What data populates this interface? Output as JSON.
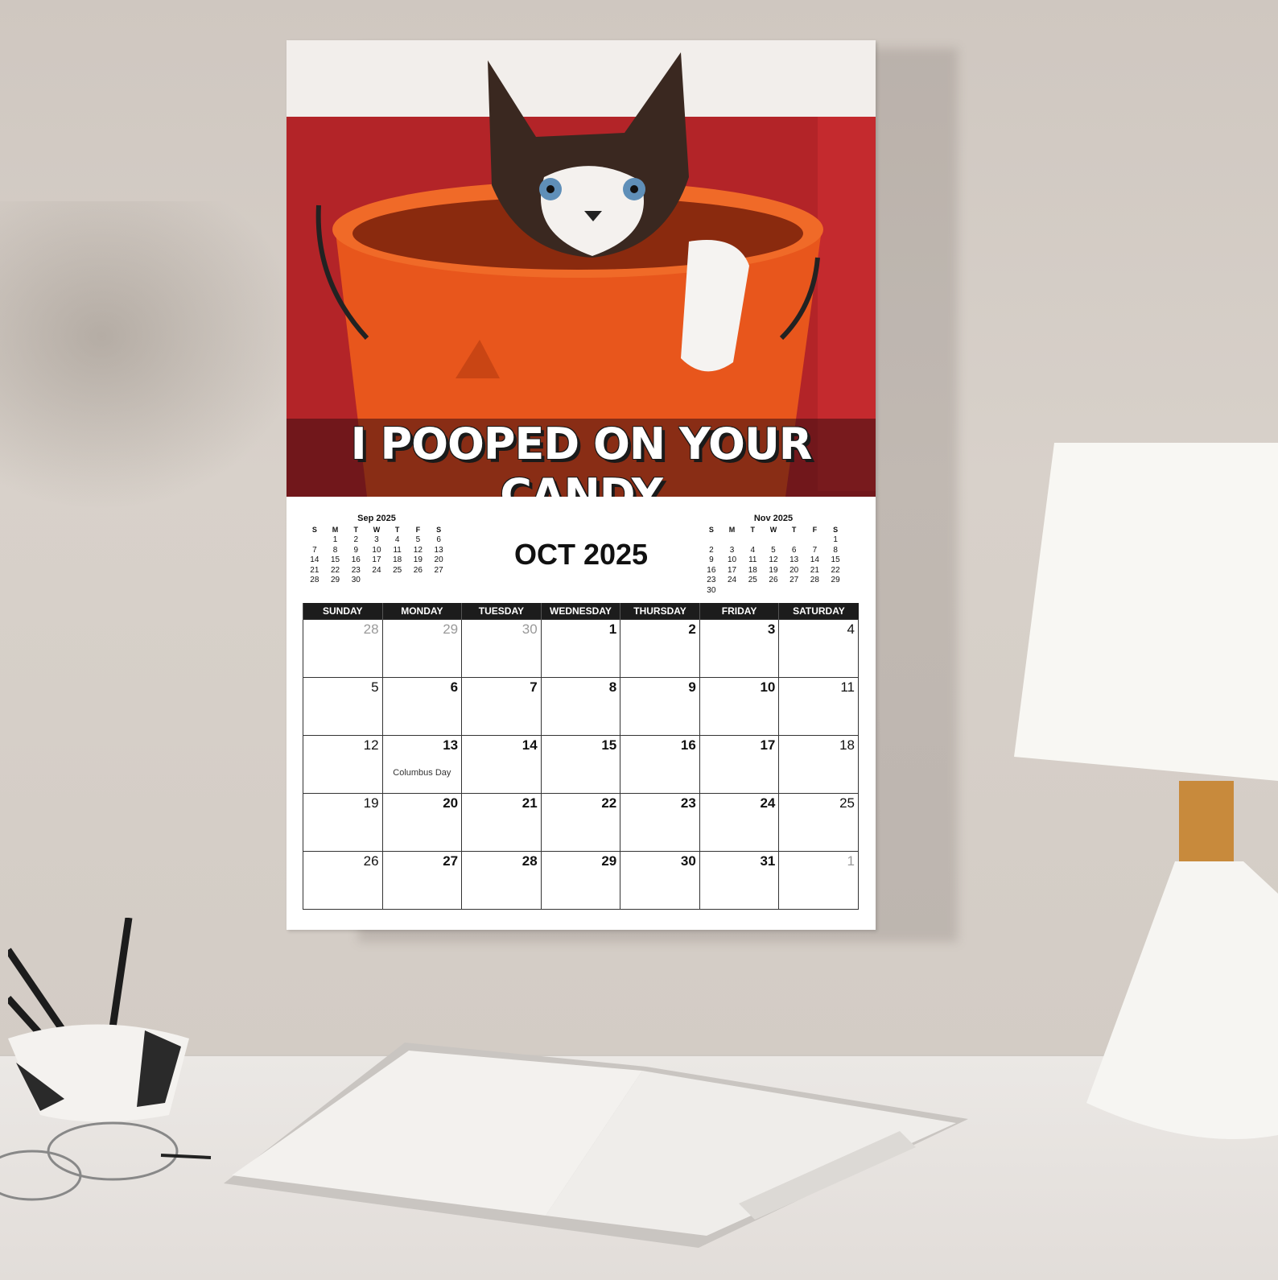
{
  "calendar": {
    "caption": "I POOPED ON YOUR CANDY",
    "month_title": "OCT 2025",
    "prev_month": {
      "title": "Sep 2025",
      "weekday_letters": [
        "S",
        "M",
        "T",
        "W",
        "T",
        "F",
        "S"
      ],
      "weeks": [
        [
          "",
          "1",
          "2",
          "3",
          "4",
          "5",
          "6"
        ],
        [
          "7",
          "8",
          "9",
          "10",
          "11",
          "12",
          "13"
        ],
        [
          "14",
          "15",
          "16",
          "17",
          "18",
          "19",
          "20"
        ],
        [
          "21",
          "22",
          "23",
          "24",
          "25",
          "26",
          "27"
        ],
        [
          "28",
          "29",
          "30",
          "",
          "",
          "",
          ""
        ]
      ]
    },
    "next_month": {
      "title": "Nov 2025",
      "weekday_letters": [
        "S",
        "M",
        "T",
        "W",
        "T",
        "F",
        "S"
      ],
      "weeks": [
        [
          "",
          "",
          "",
          "",
          "",
          "",
          "1"
        ],
        [
          "2",
          "3",
          "4",
          "5",
          "6",
          "7",
          "8"
        ],
        [
          "9",
          "10",
          "11",
          "12",
          "13",
          "14",
          "15"
        ],
        [
          "16",
          "17",
          "18",
          "19",
          "20",
          "21",
          "22"
        ],
        [
          "23",
          "24",
          "25",
          "26",
          "27",
          "28",
          "29"
        ],
        [
          "30",
          "",
          "",
          "",
          "",
          "",
          ""
        ]
      ]
    },
    "weekdays": [
      "SUNDAY",
      "MONDAY",
      "TUESDAY",
      "WEDNESDAY",
      "THURSDAY",
      "FRIDAY",
      "SATURDAY"
    ],
    "weeks": [
      [
        "28",
        "29",
        "30",
        "1",
        "2",
        "3",
        "4"
      ],
      [
        "5",
        "6",
        "7",
        "8",
        "9",
        "10",
        "11"
      ],
      [
        "12",
        "13",
        "14",
        "15",
        "16",
        "17",
        "18"
      ],
      [
        "19",
        "20",
        "21",
        "22",
        "23",
        "24",
        "25"
      ],
      [
        "26",
        "27",
        "28",
        "29",
        "30",
        "31",
        "1"
      ]
    ],
    "holiday": {
      "label": "Columbus Day"
    }
  },
  "colors": {
    "bucket": "#e8561c",
    "couch": "#b8262a",
    "header_bar": "#1c1c1c"
  }
}
